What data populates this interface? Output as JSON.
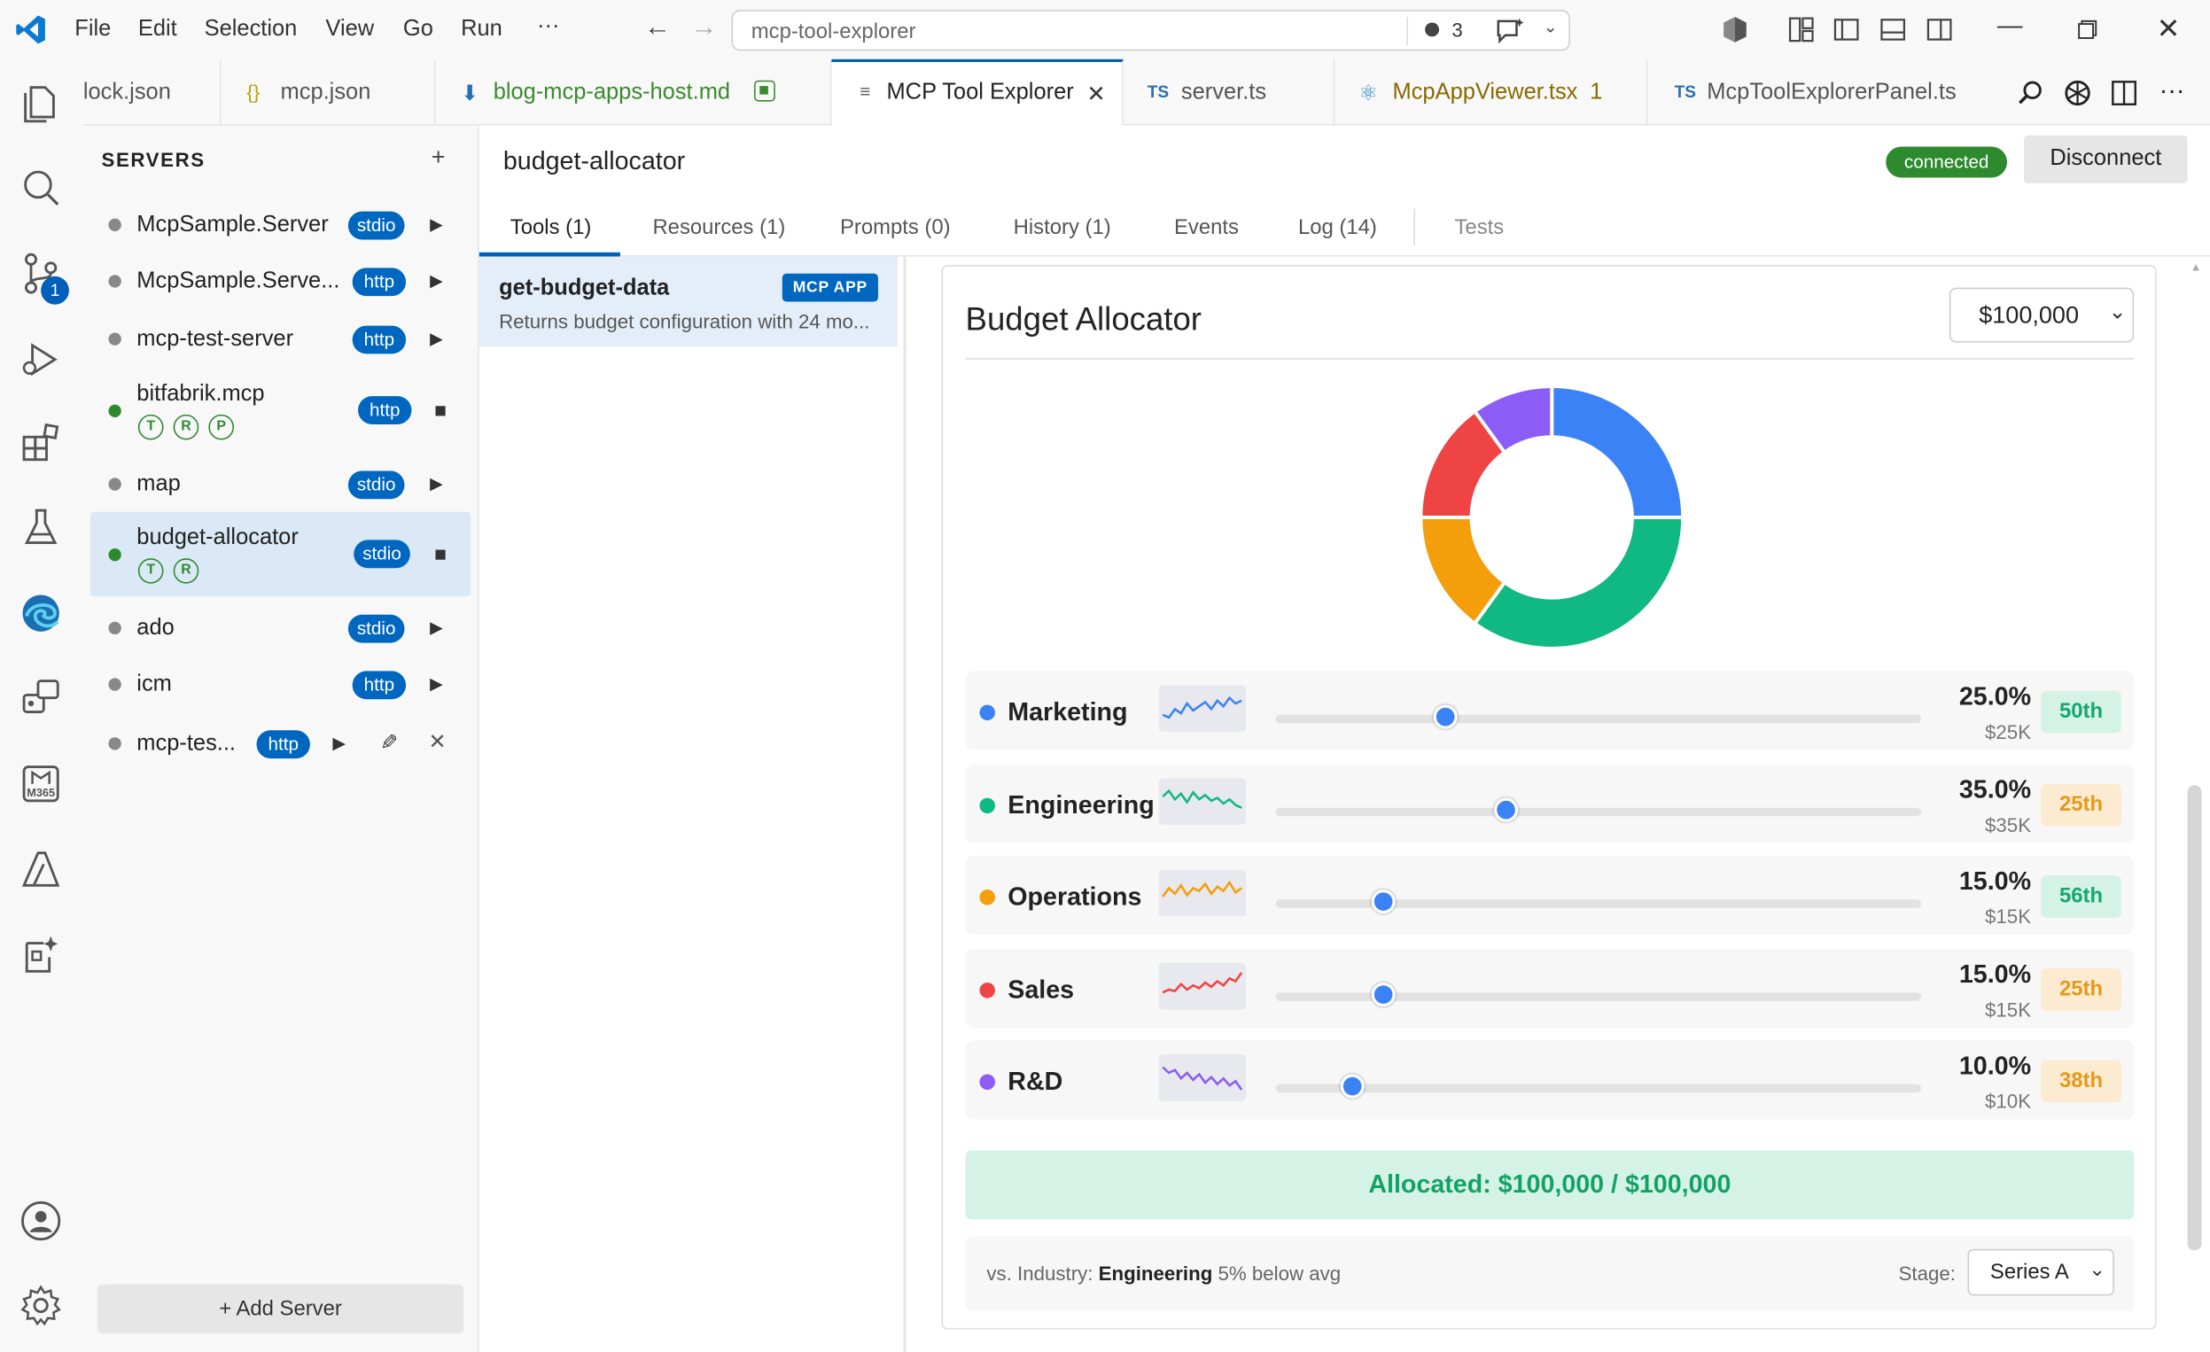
{
  "titlebar": {
    "menus": [
      "File",
      "Edit",
      "Selection",
      "View",
      "Go",
      "Run",
      "···"
    ],
    "search_text": "mcp-tool-explorer",
    "notif_count": "3"
  },
  "tabs": [
    {
      "label": "lock.json",
      "icon": "none"
    },
    {
      "label": "mcp.json",
      "icon": "braces-icon"
    },
    {
      "label": "blog-mcp-apps-host.md",
      "icon": "markdown-icon"
    },
    {
      "label": "MCP Tool Explorer",
      "icon": "preview-icon",
      "active": true
    },
    {
      "label": "server.ts",
      "icon": "ts-icon"
    },
    {
      "label": "McpAppViewer.tsx",
      "icon": "react-icon",
      "suffix": "1"
    },
    {
      "label": "McpToolExplorerPanel.ts",
      "icon": "ts-icon"
    }
  ],
  "activity_badge": "1",
  "sidebar": {
    "title": "SERVERS",
    "add": "+",
    "servers": [
      {
        "name": "McpSample.Server",
        "transport": "stdio",
        "status": "gray"
      },
      {
        "name": "McpSample.Serve...",
        "transport": "http",
        "status": "gray"
      },
      {
        "name": "mcp-test-server",
        "transport": "http",
        "status": "gray"
      },
      {
        "name": "bitfabrik.mcp",
        "transport": "http",
        "status": "green",
        "caps": [
          "T",
          "R",
          "P"
        ]
      },
      {
        "name": "map",
        "transport": "stdio",
        "status": "gray"
      },
      {
        "name": "budget-allocator",
        "transport": "stdio",
        "status": "green",
        "caps": [
          "T",
          "R"
        ],
        "selected": true
      },
      {
        "name": "ado",
        "transport": "stdio",
        "status": "gray"
      },
      {
        "name": "icm",
        "transport": "http",
        "status": "gray"
      },
      {
        "name": "mcp-tes...",
        "transport": "http",
        "status": "gray"
      }
    ],
    "add_server": "+ Add Server"
  },
  "main": {
    "server_title": "budget-allocator",
    "status": "connected",
    "disconnect": "Disconnect",
    "subtabs": [
      "Tools (1)",
      "Resources (1)",
      "Prompts (0)",
      "History (1)",
      "Events",
      "Log (14)",
      "Tests"
    ],
    "tool": {
      "name": "get-budget-data",
      "badge": "MCP APP",
      "desc": "Returns budget configuration with 24 mo..."
    }
  },
  "app": {
    "title": "Budget Allocator",
    "total_select": "$100,000",
    "categories": [
      {
        "name": "Marketing",
        "pct": "25.0%",
        "amount": "$25K",
        "rank": "50th",
        "share": 25,
        "color": "#3b82f6",
        "rank_bg": "#d5f2e6",
        "rank_fg": "#15a86e"
      },
      {
        "name": "Engineering",
        "pct": "35.0%",
        "amount": "$35K",
        "rank": "25th",
        "share": 35,
        "color": "#10b981",
        "rank_bg": "#fcebd0",
        "rank_fg": "#e39a1c"
      },
      {
        "name": "Operations",
        "pct": "15.0%",
        "amount": "$15K",
        "rank": "56th",
        "share": 15,
        "color": "#f59e0b",
        "rank_bg": "#d5f2e6",
        "rank_fg": "#15a86e"
      },
      {
        "name": "Sales",
        "pct": "15.0%",
        "amount": "$15K",
        "rank": "25th",
        "share": 15,
        "color": "#ef4444",
        "rank_bg": "#fcebd0",
        "rank_fg": "#e39a1c"
      },
      {
        "name": "R&D",
        "pct": "10.0%",
        "amount": "$10K",
        "rank": "38th",
        "share": 10,
        "color": "#8b5cf6",
        "rank_bg": "#fcebd0",
        "rank_fg": "#e39a1c"
      }
    ],
    "allocated": "Allocated: $100,000 / $100,000",
    "industry_prefix": "vs. Industry:",
    "industry_cat": "Engineering",
    "industry_suffix": "5% below avg",
    "stage_label": "Stage:",
    "stage_value": "Series A"
  }
}
